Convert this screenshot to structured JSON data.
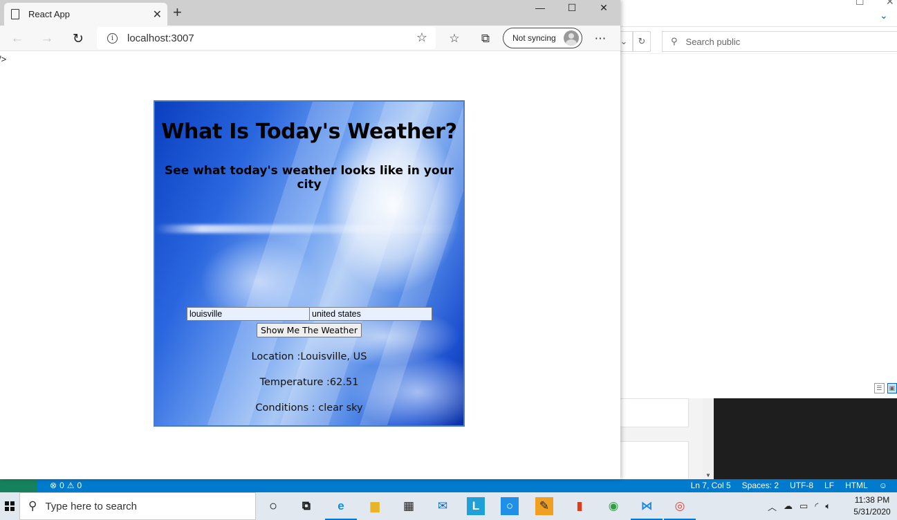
{
  "browser": {
    "tab_title": "React App",
    "url": "localhost:3007",
    "sync_label": "Not syncing",
    "window_controls": {
      "minimize": "—",
      "maximize": "☐",
      "close": "✕"
    }
  },
  "page": {
    "stray_text": "/>",
    "heading": "What Is Today's Weather?",
    "subheading": "See what today's weather looks like in your city",
    "city_input": "louisville",
    "country_input": "united states",
    "submit_label": "Show Me The Weather",
    "location": "Location :Louisville, US",
    "temperature": "Temperature :62.51",
    "conditions": "Conditions : clear sky"
  },
  "background_window": {
    "search_placeholder": "Search public"
  },
  "status_bar": {
    "errors": "0",
    "warnings": "0",
    "cursor": "Ln 7, Col 5",
    "spaces": "Spaces: 2",
    "encoding": "UTF-8",
    "eol": "LF",
    "language": "HTML"
  },
  "taskbar": {
    "search_placeholder": "Type here to search",
    "time": "11:38 PM",
    "date": "5/31/2020"
  },
  "colors": {
    "accent": "#0078d4",
    "vscode_status": "#007acc",
    "card_border": "#4d7cc4"
  }
}
